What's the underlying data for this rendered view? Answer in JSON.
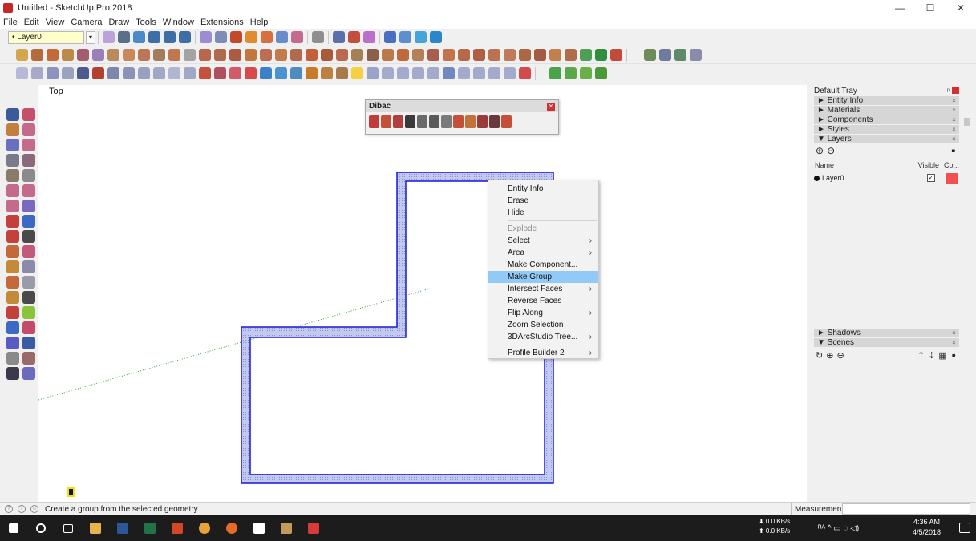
{
  "window": {
    "title": "Untitled - SketchUp Pro 2018",
    "minimize": "—",
    "maximize": "☐",
    "close": "✕"
  },
  "menu": [
    "File",
    "Edit",
    "View",
    "Camera",
    "Draw",
    "Tools",
    "Window",
    "Extensions",
    "Help"
  ],
  "toolbar": {
    "layer_select": "• Layer0",
    "layer_arrow": "▾"
  },
  "viewport": {
    "view_label": "Top"
  },
  "dibac": {
    "title": "Dibac",
    "close": "×"
  },
  "context_menu": {
    "items": [
      {
        "label": "Entity Info",
        "arrow": ""
      },
      {
        "label": "Erase",
        "arrow": ""
      },
      {
        "label": "Hide",
        "arrow": ""
      },
      {
        "label": "Explode",
        "arrow": ""
      },
      {
        "label": "Select",
        "arrow": "›"
      },
      {
        "label": "Area",
        "arrow": "›"
      },
      {
        "label": "Make Component...",
        "arrow": ""
      },
      {
        "label": "Make Group",
        "arrow": ""
      },
      {
        "label": "Intersect Faces",
        "arrow": "›"
      },
      {
        "label": "Reverse Faces",
        "arrow": ""
      },
      {
        "label": "Flip Along",
        "arrow": "›"
      },
      {
        "label": "Zoom Selection",
        "arrow": ""
      },
      {
        "label": "3DArcStudio Tree...",
        "arrow": "›"
      },
      {
        "label": "Profile Builder 2",
        "arrow": "›"
      }
    ]
  },
  "tray": {
    "title": "Default Tray",
    "pin": "ᵖ",
    "panels_top": [
      {
        "label": "► Entity Info"
      },
      {
        "label": "► Materials"
      },
      {
        "label": "► Components"
      },
      {
        "label": "► Styles"
      },
      {
        "label": "▼ Layers"
      }
    ],
    "layer_add": "⊕",
    "layer_remove": "⊖",
    "layer_details": "➧",
    "layers_header": {
      "name": "Name",
      "visible": "Visible",
      "color": "Co..."
    },
    "layer_rows": [
      {
        "name": "Layer0",
        "visible": "✓",
        "color": "#f05050"
      }
    ],
    "panels_bottom": [
      {
        "label": "► Shadows"
      },
      {
        "label": "▼ Scenes"
      }
    ],
    "scene_update": "↻",
    "scene_add": "⊕",
    "scene_remove": "⊖",
    "scene_up": "⇡",
    "scene_down": "⇣",
    "scene_view": "▦",
    "scene_details": "➧",
    "panel_close": "×"
  },
  "status": {
    "icon1": "?",
    "icon2": "i",
    "icon3": "☺",
    "text": "Create a group from the selected geometry",
    "measurements_label": "Measurements"
  },
  "taskbar": {
    "net_down": "⬇ 0.0 KB/s",
    "net_up": "⬆ 0.0 KB/s",
    "tray_icons": "ᴿᴬ  ^  ▭  ◌  ◁)",
    "time": "4:36 AM",
    "date": "4/5/2018"
  },
  "colors": {
    "shape_stroke": "#1818d8",
    "shape_fill": "#b6bcea",
    "selection_highlight": "#91c9f7",
    "layer_color": "#f05050"
  }
}
